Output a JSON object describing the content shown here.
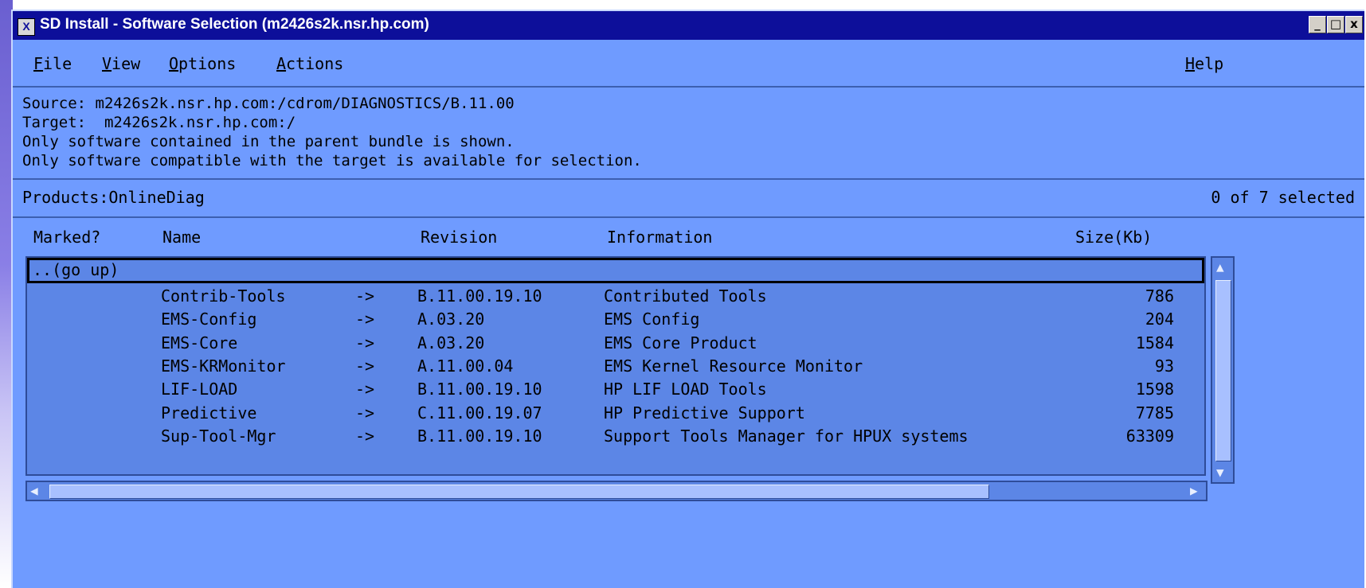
{
  "window": {
    "title": "SD Install - Software Selection (m2426s2k.nsr.hp.com)",
    "app_icon": "X",
    "controls": {
      "minimize": "_",
      "maximize": "□",
      "close": "x"
    }
  },
  "menu": {
    "file": "File",
    "view": "View",
    "options": "Options",
    "actions": "Actions",
    "help": "Help"
  },
  "info": {
    "source": "Source: m2426s2k.nsr.hp.com:/cdrom/DIAGNOSTICS/B.11.00",
    "target": "Target:  m2426s2k.nsr.hp.com:/",
    "note1": "Only software contained in the parent bundle is shown.",
    "note2": "Only software compatible with the target is available for selection."
  },
  "products": {
    "label": "Products:OnlineDiag",
    "selected_count": "0 of 7 selected"
  },
  "table": {
    "headers": {
      "marked": "Marked?",
      "name": "Name",
      "revision": "Revision",
      "information": "Information",
      "size": "Size(Kb)"
    },
    "go_up": "..(go up)",
    "rows": [
      {
        "marked": "",
        "name": "Contrib-Tools",
        "arrow": "->",
        "revision": "B.11.00.19.10",
        "information": "Contributed Tools",
        "size": "786"
      },
      {
        "marked": "",
        "name": "EMS-Config",
        "arrow": "->",
        "revision": "A.03.20",
        "information": "EMS Config",
        "size": "204"
      },
      {
        "marked": "",
        "name": "EMS-Core",
        "arrow": "->",
        "revision": "A.03.20",
        "information": "EMS Core Product",
        "size": "1584"
      },
      {
        "marked": "",
        "name": "EMS-KRMonitor",
        "arrow": "->",
        "revision": "A.11.00.04",
        "information": "EMS Kernel Resource Monitor",
        "size": "93"
      },
      {
        "marked": "",
        "name": "LIF-LOAD",
        "arrow": "->",
        "revision": "B.11.00.19.10",
        "information": "HP LIF LOAD Tools",
        "size": "1598"
      },
      {
        "marked": "",
        "name": "Predictive",
        "arrow": "->",
        "revision": "C.11.00.19.07",
        "information": "HP Predictive Support",
        "size": "7785"
      },
      {
        "marked": "",
        "name": "Sup-Tool-Mgr",
        "arrow": "->",
        "revision": "B.11.00.19.10",
        "information": "Support Tools Manager for HPUX systems",
        "size": "63309"
      }
    ]
  }
}
